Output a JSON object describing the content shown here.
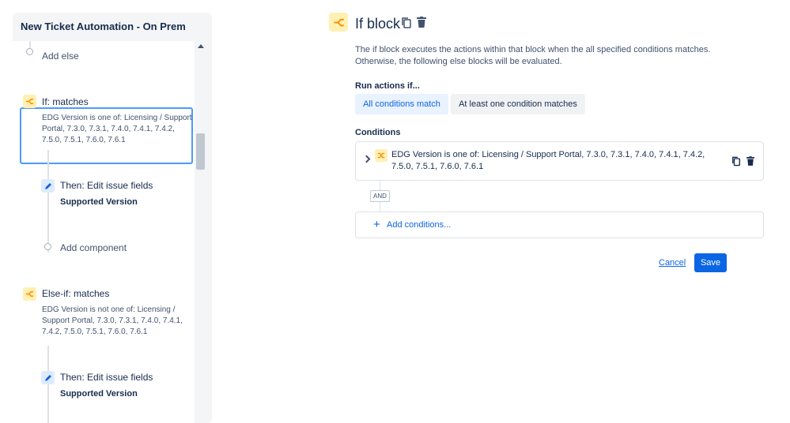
{
  "panel": {
    "title": "New Ticket Automation - On Prem",
    "items": [
      {
        "label": "Add else"
      },
      {
        "title": "If: matches",
        "desc": "EDG Version is one of: Licensing / Support Portal, 7.3.0, 7.3.1, 7.4.0, 7.4.1, 7.4.2, 7.5.0, 7.5.1, 7.6.0, 7.6.1"
      },
      {
        "title": "Then: Edit issue fields",
        "sub": "Supported Version"
      },
      {
        "label": "Add component"
      },
      {
        "title": "Else-if: matches",
        "desc": "EDG Version is not one of: Licensing / Support Portal, 7.3.0, 7.3.1, 7.4.0, 7.4.1, 7.4.2, 7.5.0, 7.5.1, 7.6.0, 7.6.1"
      },
      {
        "title": "Then: Edit issue fields",
        "sub": "Supported Version"
      }
    ]
  },
  "detail": {
    "title": "If block",
    "description": "The if block executes the actions within that block when the all specified conditions matches. Otherwise, the following else blocks will be evaluated.",
    "run_label": "Run actions if...",
    "options": [
      "All conditions match",
      "At least one condition matches"
    ],
    "selected_option": "All conditions match",
    "conditions_label": "Conditions",
    "condition_text": "EDG Version is one of: Licensing / Support Portal, 7.3.0, 7.3.1, 7.4.0, 7.4.1, 7.4.2, 7.5.0, 7.5.1, 7.6.0, 7.6.1",
    "and_label": "AND",
    "add_conditions": "Add conditions...",
    "cancel": "Cancel",
    "save": "Save"
  },
  "colors": {
    "accent": "#0c66e4",
    "branch_bg": "#fff0b3",
    "selected_border": "#4c9aff"
  }
}
